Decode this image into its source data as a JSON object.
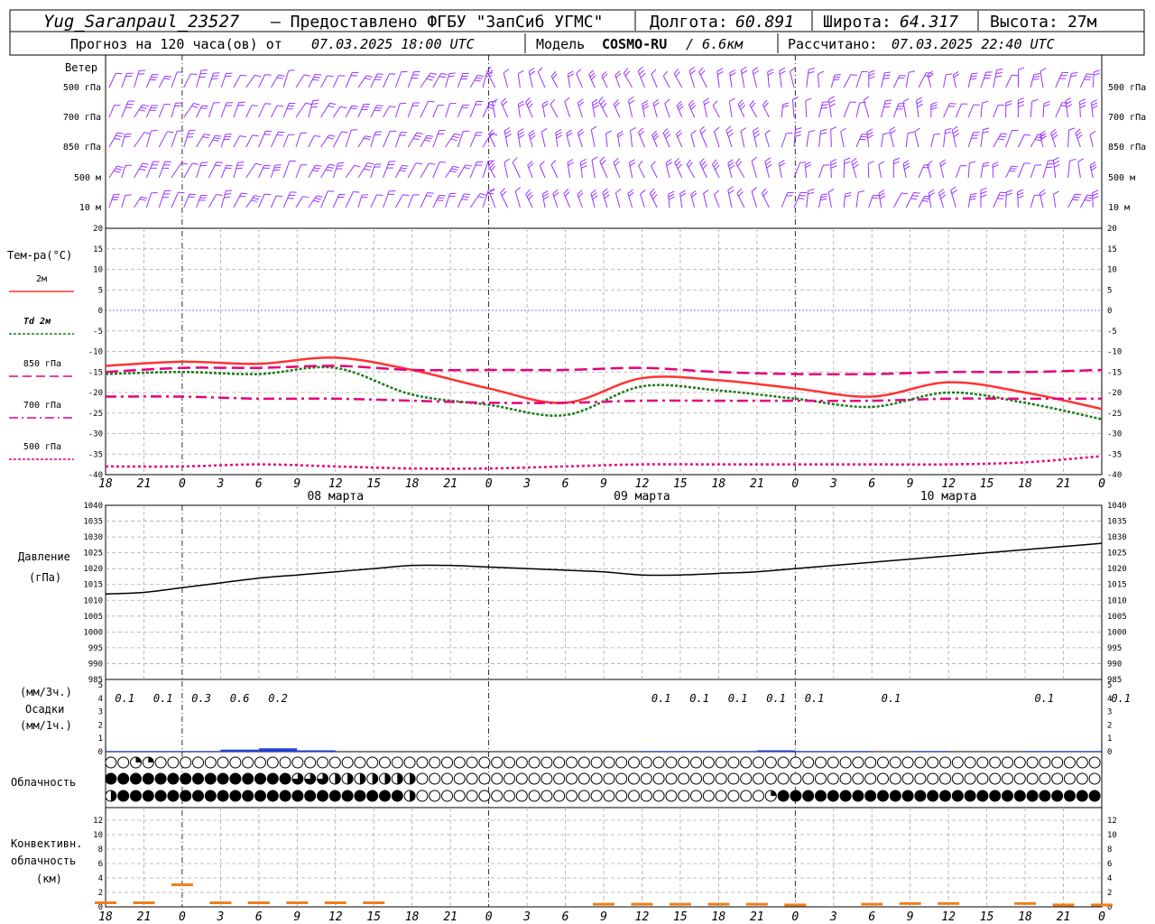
{
  "header": {
    "station": "Yug_Saranpaul_23527",
    "provider": "– Предоставлено ФГБУ \"ЗапСиб УГМС\"",
    "lon_label": "Долгота:",
    "lon_value": "60.891",
    "lat_label": "Широта:",
    "lat_value": "64.317",
    "alt_label": "Высота:",
    "alt_value": "27м",
    "forecast_label": "Прогноз на 120 часа(ов) от",
    "forecast_start": "07.03.2025 18:00 UTC",
    "model_label": "Модель",
    "model_name": "COSMO-RU",
    "model_res": "/ 6.6км",
    "calc_label": "Рассчитано:",
    "calc_time": "07.03.2025 22:40 UTC"
  },
  "time_axis": {
    "hour_labels": [
      "18",
      "21",
      "0",
      "3",
      "6",
      "9",
      "12",
      "15",
      "18",
      "21",
      "0",
      "3",
      "6",
      "9",
      "12",
      "15",
      "18",
      "21",
      "0",
      "3",
      "6",
      "9",
      "12",
      "15",
      "18",
      "21",
      "0"
    ],
    "day_labels": [
      "08 марта",
      "09 марта",
      "10 марта"
    ],
    "bottom_labels": [
      "18",
      "21",
      "0",
      "3",
      "6",
      "9",
      "12",
      "15",
      "18",
      "21",
      "0",
      "3",
      "6",
      "9",
      "12",
      "15",
      "18",
      "21",
      "0",
      "3",
      "6",
      "9",
      "12",
      "15",
      "18",
      "21",
      "0"
    ]
  },
  "wind_panel": {
    "title": "Ветер",
    "levels": [
      "500 гПа",
      "700 гПа",
      "850 гПа",
      "500 м",
      "10  м"
    ],
    "barb_color": "#9933ff"
  },
  "temp_panel": {
    "title": "Тем-ра(°С)",
    "legend": [
      {
        "label": "2м",
        "color": "#ff3333"
      },
      {
        "label": "Td  2м",
        "color": "#1a7a1a"
      },
      {
        "label": "850 гПа",
        "color": "#e6007a"
      },
      {
        "label": "700 гПа",
        "color": "#e6007a"
      },
      {
        "label": "500 гПа",
        "color": "#e6007a"
      }
    ],
    "ticks": [
      "20",
      "15",
      "10",
      "5",
      "0",
      "-5",
      "-10",
      "-15",
      "-20",
      "-25",
      "-30",
      "-35",
      "-40"
    ]
  },
  "pressure_panel": {
    "title": "Давление",
    "unit": "(гПа)",
    "ticks": [
      "1040",
      "1035",
      "1030",
      "1025",
      "1020",
      "1015",
      "1010",
      "1005",
      "1000",
      "995",
      "990",
      "985"
    ]
  },
  "precip_panel": {
    "unit_3h": "(мм/3ч.)",
    "title": "Осадки",
    "unit_1h": "(мм/1ч.)",
    "ticks": [
      "5",
      "4",
      "3",
      "2",
      "1",
      "0"
    ],
    "labels": [
      {
        "h": 3,
        "v": "0.1"
      },
      {
        "h": 6,
        "v": "0.1"
      },
      {
        "h": 9,
        "v": "0.3"
      },
      {
        "h": 12,
        "v": "0.6"
      },
      {
        "h": 15,
        "v": "0.2"
      },
      {
        "h": 45,
        "v": "0.1"
      },
      {
        "h": 48,
        "v": "0.1"
      },
      {
        "h": 51,
        "v": "0.1"
      },
      {
        "h": 54,
        "v": "0.1"
      },
      {
        "h": 57,
        "v": "0.1"
      },
      {
        "h": 63,
        "v": "0.1"
      },
      {
        "h": 75,
        "v": "0.1"
      },
      {
        "h": 81,
        "v": "0.1"
      }
    ]
  },
  "cloud_panel": {
    "title": "Облачность"
  },
  "conv_panel": {
    "title_1": "Конвективн.",
    "title_2": "облачность",
    "unit": "(км)",
    "ticks": [
      "12",
      "10",
      "8",
      "6",
      "4",
      "2",
      "0"
    ]
  },
  "chart_data": {
    "type": "line",
    "x_unit": "hours from 07.03.2025 18:00 UTC",
    "xlim": [
      0,
      78
    ],
    "temperature": {
      "ylim": [
        -40,
        20
      ],
      "series": [
        {
          "name": "2м",
          "x": [
            0,
            6,
            12,
            18,
            24,
            30,
            36,
            42,
            48,
            54,
            60,
            66,
            72,
            78
          ],
          "values": [
            -13.5,
            -12.5,
            -13,
            -11.5,
            -14.5,
            -19,
            -22.5,
            -16.5,
            -17,
            -19,
            -21,
            -17.5,
            -20,
            -24
          ]
        },
        {
          "name": "Td  2м",
          "x": [
            0,
            6,
            12,
            18,
            24,
            30,
            36,
            42,
            48,
            54,
            60,
            66,
            72,
            78
          ],
          "values": [
            -15.5,
            -15,
            -15.5,
            -14,
            -20.5,
            -23,
            -25.5,
            -18.5,
            -19.5,
            -21.5,
            -23.5,
            -20,
            -22.5,
            -26.5
          ]
        },
        {
          "name": "850 гПа",
          "x": [
            0,
            6,
            12,
            18,
            24,
            30,
            36,
            42,
            48,
            54,
            60,
            66,
            72,
            78
          ],
          "values": [
            -15,
            -14,
            -14,
            -13.5,
            -14.5,
            -14.5,
            -14.5,
            -14,
            -15,
            -15.5,
            -15.5,
            -15,
            -15,
            -14.5
          ]
        },
        {
          "name": "700 гПа",
          "x": [
            0,
            6,
            12,
            18,
            24,
            30,
            36,
            42,
            48,
            54,
            60,
            66,
            72,
            78
          ],
          "values": [
            -21,
            -21,
            -21.5,
            -21.5,
            -22,
            -22.5,
            -22.5,
            -22,
            -22,
            -22,
            -22,
            -21.5,
            -21.5,
            -21.5
          ]
        },
        {
          "name": "500 гПа",
          "x": [
            0,
            6,
            12,
            18,
            24,
            30,
            36,
            42,
            48,
            54,
            60,
            66,
            72,
            78
          ],
          "values": [
            -38,
            -38,
            -37.5,
            -38,
            -38.5,
            -38.5,
            -38,
            -37.5,
            -37.5,
            -37.5,
            -37.5,
            -37.5,
            -37,
            -35.5
          ]
        }
      ]
    },
    "pressure": {
      "ylim": [
        985,
        1040
      ],
      "x": [
        0,
        3,
        6,
        9,
        12,
        15,
        18,
        21,
        24,
        27,
        30,
        33,
        36,
        39,
        42,
        45,
        48,
        51,
        54,
        57,
        60,
        63,
        66,
        69,
        72,
        75,
        78
      ],
      "values": [
        1012,
        1012.5,
        1014,
        1015.5,
        1017,
        1018,
        1019,
        1020,
        1021,
        1021,
        1020.5,
        1020,
        1019.5,
        1019,
        1018,
        1018,
        1018.5,
        1019,
        1020,
        1021,
        1022,
        1023,
        1024,
        1025,
        1026,
        1027,
        1028
      ]
    },
    "precipitation": {
      "ylim": [
        0,
        5
      ],
      "x": [
        0,
        3,
        6,
        9,
        12,
        15,
        18,
        21,
        24,
        27,
        30,
        33,
        36,
        39,
        42,
        45,
        48,
        51,
        54,
        57,
        60,
        63,
        66,
        69,
        72,
        75,
        78
      ],
      "values": [
        0.05,
        0.05,
        0.05,
        0.15,
        0.25,
        0.1,
        0,
        0,
        0,
        0,
        0,
        0,
        0,
        0,
        0.05,
        0.05,
        0.05,
        0.1,
        0.05,
        0.05,
        0,
        0.05,
        0,
        0,
        0.05,
        0.05,
        0
      ]
    },
    "cloud_cover": {
      "rows": [
        "upper",
        "middle",
        "lower"
      ],
      "state_codes": "0 clear, 1 one quarter, 2 half, 3 three quarters, 4 overcast",
      "upper": [
        0,
        0,
        1,
        1,
        0,
        0,
        0,
        0,
        0,
        0,
        0,
        0,
        0,
        0,
        0,
        0,
        0,
        0,
        0,
        0,
        0,
        0,
        0,
        0,
        0,
        0,
        0,
        0,
        0,
        0,
        0,
        0,
        0,
        0,
        0,
        0,
        0,
        0,
        0,
        0,
        0,
        0,
        0,
        0,
        0,
        0,
        0,
        0,
        0,
        0,
        0,
        0,
        0,
        0,
        0,
        0,
        0,
        0,
        0,
        0,
        0,
        0,
        0,
        0,
        0,
        0,
        0,
        0,
        0,
        0,
        0,
        0,
        0,
        0,
        0,
        0,
        0,
        0,
        0,
        0
      ],
      "middle": [
        4,
        4,
        4,
        4,
        4,
        4,
        4,
        4,
        4,
        4,
        4,
        4,
        4,
        4,
        4,
        3,
        3,
        3,
        2,
        2,
        2,
        2,
        2,
        2,
        2,
        0,
        0,
        0,
        0,
        0,
        0,
        0,
        0,
        0,
        0,
        0,
        0,
        0,
        0,
        0,
        0,
        0,
        0,
        0,
        0,
        0,
        0,
        0,
        0,
        0,
        0,
        0,
        0,
        0,
        0,
        0,
        0,
        0,
        0,
        0,
        0,
        0,
        0,
        0,
        0,
        0,
        0,
        0,
        0,
        0,
        0,
        0,
        0,
        0,
        0,
        0,
        0,
        0,
        0,
        0
      ],
      "lower": [
        2,
        4,
        4,
        4,
        4,
        4,
        4,
        4,
        4,
        4,
        4,
        4,
        4,
        4,
        4,
        4,
        4,
        4,
        4,
        4,
        4,
        4,
        4,
        4,
        2,
        0,
        0,
        0,
        0,
        0,
        0,
        0,
        0,
        0,
        0,
        0,
        0,
        0,
        0,
        0,
        0,
        0,
        0,
        0,
        0,
        0,
        0,
        0,
        0,
        0,
        0,
        0,
        0,
        1,
        4,
        4,
        4,
        4,
        4,
        4,
        4,
        4,
        4,
        4,
        4,
        4,
        4,
        4,
        4,
        4,
        4,
        4,
        4,
        4,
        4,
        4,
        4,
        4,
        4,
        4
      ]
    },
    "convective": {
      "ylim": [
        0,
        13
      ],
      "x": [
        0,
        3,
        6,
        9,
        12,
        15,
        18,
        21,
        24,
        27,
        30,
        33,
        36,
        39,
        42,
        45,
        48,
        51,
        54,
        57,
        60,
        63,
        66,
        69,
        72,
        75,
        78
      ],
      "values": [
        0.5,
        0.5,
        3,
        0.5,
        0.5,
        0.5,
        0.5,
        0.5,
        0,
        0,
        0,
        0,
        0,
        0.3,
        0.3,
        0.3,
        0.3,
        0.3,
        0.2,
        0,
        0.3,
        0.4,
        0.4,
        0,
        0.4,
        0.2,
        0.2
      ]
    }
  }
}
